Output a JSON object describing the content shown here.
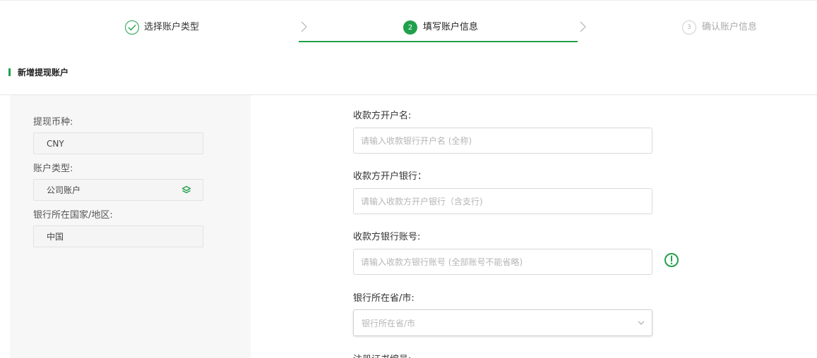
{
  "steps": [
    {
      "label": "选择账户类型",
      "state": "done"
    },
    {
      "number": "2",
      "label": "填写账户信息",
      "state": "active"
    },
    {
      "number": "3",
      "label": "确认账户信息",
      "state": "pending"
    }
  ],
  "section": {
    "title": "新增提现账户"
  },
  "left_panel": {
    "currency": {
      "label": "提现币种:",
      "value": "CNY"
    },
    "account_type": {
      "label": "账户类型:",
      "value": "公司账户",
      "icon": "layers-icon"
    },
    "country": {
      "label": "银行所在国家/地区:",
      "value": "中国"
    }
  },
  "form": {
    "payee_name": {
      "label": "收款方开户名:",
      "placeholder": "请输入收款银行开户名 (全称)"
    },
    "payee_bank": {
      "label": "收款方开户银行：",
      "placeholder": "请输入收款方开户银行（含支行)"
    },
    "payee_account": {
      "label": "收款方银行账号:",
      "placeholder": "请输入收款方银行账号 (全部账号不能省略)"
    },
    "bank_province": {
      "label": "银行所在省/市:",
      "placeholder": "银行所在省/市"
    },
    "next_label": {
      "label": "注册证书编号:"
    }
  },
  "colors": {
    "accent": "#21a04b",
    "panel_bg": "#f7f7f7",
    "border": "#d9d9d9"
  }
}
